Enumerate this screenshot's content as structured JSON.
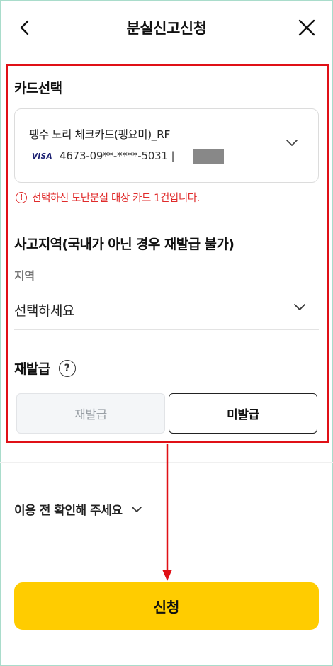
{
  "header": {
    "title": "분실신고신청",
    "back_icon": "chevron-left-icon",
    "close_icon": "close-icon"
  },
  "card_section": {
    "title": "카드선택",
    "card_name": "펭수 노리 체크카드(펭요미)_RF",
    "card_brand": "VISA",
    "card_number": "4673-09**-****-5031 |",
    "warning": "선택하신 도난분실 대상 카드 1건입니다."
  },
  "region_section": {
    "title": "사고지역(국내가 아닌 경우 재발급 불가)",
    "field_label": "지역",
    "selected_value": "선택하세요"
  },
  "reissue_section": {
    "title": "재발급",
    "help_glyph": "?",
    "options": [
      "재발급",
      "미발급"
    ],
    "selected": "미발급"
  },
  "notice": {
    "label": "이용 전 확인해 주세요"
  },
  "submit": {
    "label": "신청"
  },
  "colors": {
    "highlight": "#e01016",
    "warning": "#e02b2b",
    "submit_bg": "#ffcc00"
  }
}
